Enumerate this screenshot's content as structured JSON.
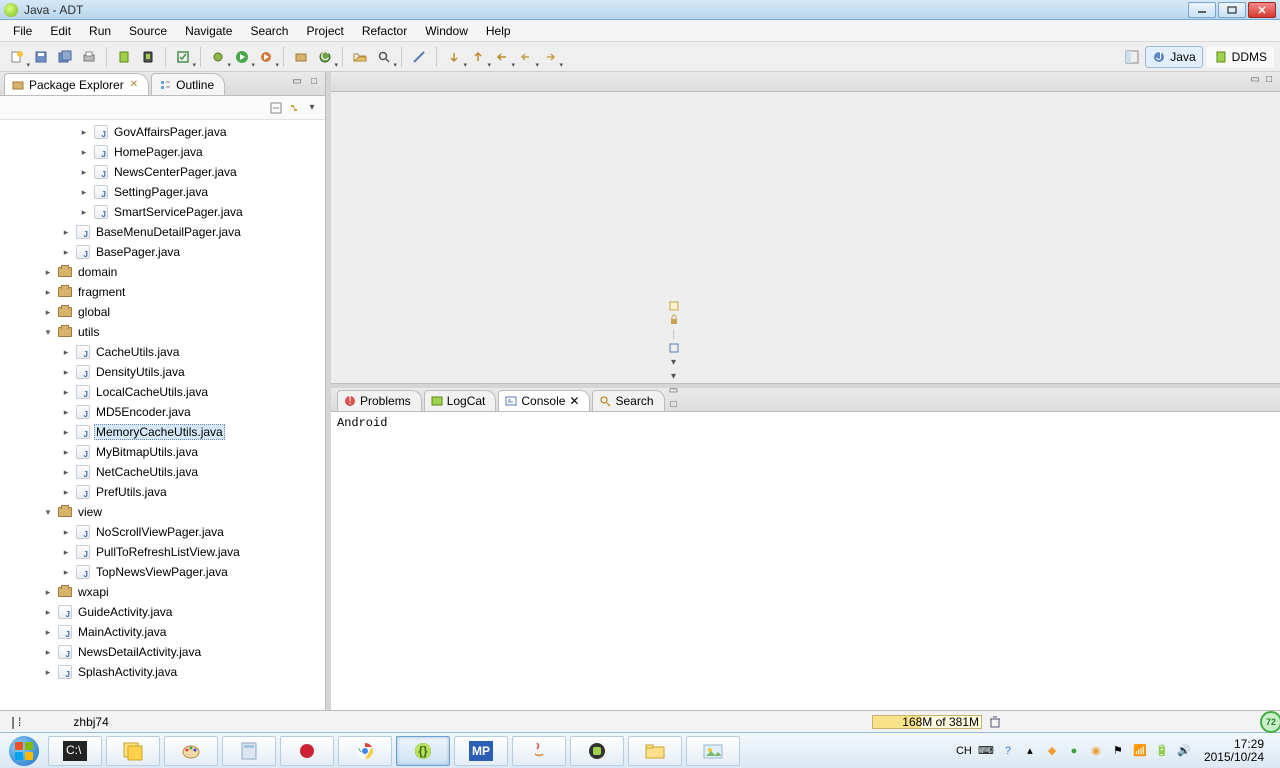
{
  "title": "Java - ADT",
  "menu": [
    "File",
    "Edit",
    "Run",
    "Source",
    "Navigate",
    "Search",
    "Project",
    "Refactor",
    "Window",
    "Help"
  ],
  "perspectives": {
    "java": "Java",
    "ddms": "DDMS"
  },
  "views": {
    "package_explorer": "Package Explorer",
    "outline": "Outline"
  },
  "tree": [
    {
      "depth": 4,
      "twisty": "closed",
      "icon": "java",
      "label": "GovAffairsPager.java"
    },
    {
      "depth": 4,
      "twisty": "closed",
      "icon": "java",
      "label": "HomePager.java"
    },
    {
      "depth": 4,
      "twisty": "closed",
      "icon": "java",
      "label": "NewsCenterPager.java"
    },
    {
      "depth": 4,
      "twisty": "closed",
      "icon": "java",
      "label": "SettingPager.java"
    },
    {
      "depth": 4,
      "twisty": "closed",
      "icon": "java",
      "label": "SmartServicePager.java"
    },
    {
      "depth": 3,
      "twisty": "closed",
      "icon": "java",
      "label": "BaseMenuDetailPager.java"
    },
    {
      "depth": 3,
      "twisty": "closed",
      "icon": "java",
      "label": "BasePager.java"
    },
    {
      "depth": 2,
      "twisty": "closed",
      "icon": "pkg",
      "label": "domain"
    },
    {
      "depth": 2,
      "twisty": "closed",
      "icon": "pkg",
      "label": "fragment"
    },
    {
      "depth": 2,
      "twisty": "closed",
      "icon": "pkg",
      "label": "global"
    },
    {
      "depth": 2,
      "twisty": "open",
      "icon": "pkg",
      "label": "utils"
    },
    {
      "depth": 3,
      "twisty": "closed",
      "icon": "java",
      "label": "CacheUtils.java"
    },
    {
      "depth": 3,
      "twisty": "closed",
      "icon": "java",
      "label": "DensityUtils.java"
    },
    {
      "depth": 3,
      "twisty": "closed",
      "icon": "java",
      "label": "LocalCacheUtils.java"
    },
    {
      "depth": 3,
      "twisty": "closed",
      "icon": "java",
      "label": "MD5Encoder.java"
    },
    {
      "depth": 3,
      "twisty": "closed",
      "icon": "java",
      "label": "MemoryCacheUtils.java",
      "selected": true
    },
    {
      "depth": 3,
      "twisty": "closed",
      "icon": "java",
      "label": "MyBitmapUtils.java"
    },
    {
      "depth": 3,
      "twisty": "closed",
      "icon": "java",
      "label": "NetCacheUtils.java"
    },
    {
      "depth": 3,
      "twisty": "closed",
      "icon": "java",
      "label": "PrefUtils.java"
    },
    {
      "depth": 2,
      "twisty": "open",
      "icon": "pkg",
      "label": "view"
    },
    {
      "depth": 3,
      "twisty": "closed",
      "icon": "java",
      "label": "NoScrollViewPager.java"
    },
    {
      "depth": 3,
      "twisty": "closed",
      "icon": "java",
      "label": "PullToRefreshListView.java"
    },
    {
      "depth": 3,
      "twisty": "closed",
      "icon": "java",
      "label": "TopNewsViewPager.java"
    },
    {
      "depth": 2,
      "twisty": "closed",
      "icon": "pkg",
      "label": "wxapi"
    },
    {
      "depth": 2,
      "twisty": "closed",
      "icon": "java",
      "label": "GuideActivity.java"
    },
    {
      "depth": 2,
      "twisty": "closed",
      "icon": "java",
      "label": "MainActivity.java"
    },
    {
      "depth": 2,
      "twisty": "closed",
      "icon": "java",
      "label": "NewsDetailActivity.java"
    },
    {
      "depth": 2,
      "twisty": "closed",
      "icon": "java",
      "label": "SplashActivity.java"
    }
  ],
  "bottom_tabs": {
    "problems": "Problems",
    "logcat": "LogCat",
    "console": "Console",
    "search": "Search"
  },
  "console_body": "Android",
  "status": {
    "project": "zhbj74",
    "heap": "168M of 381M"
  },
  "edge_badge": "72",
  "tray": {
    "ime": "CH",
    "time": "17:29",
    "date": "2015/10/24"
  }
}
